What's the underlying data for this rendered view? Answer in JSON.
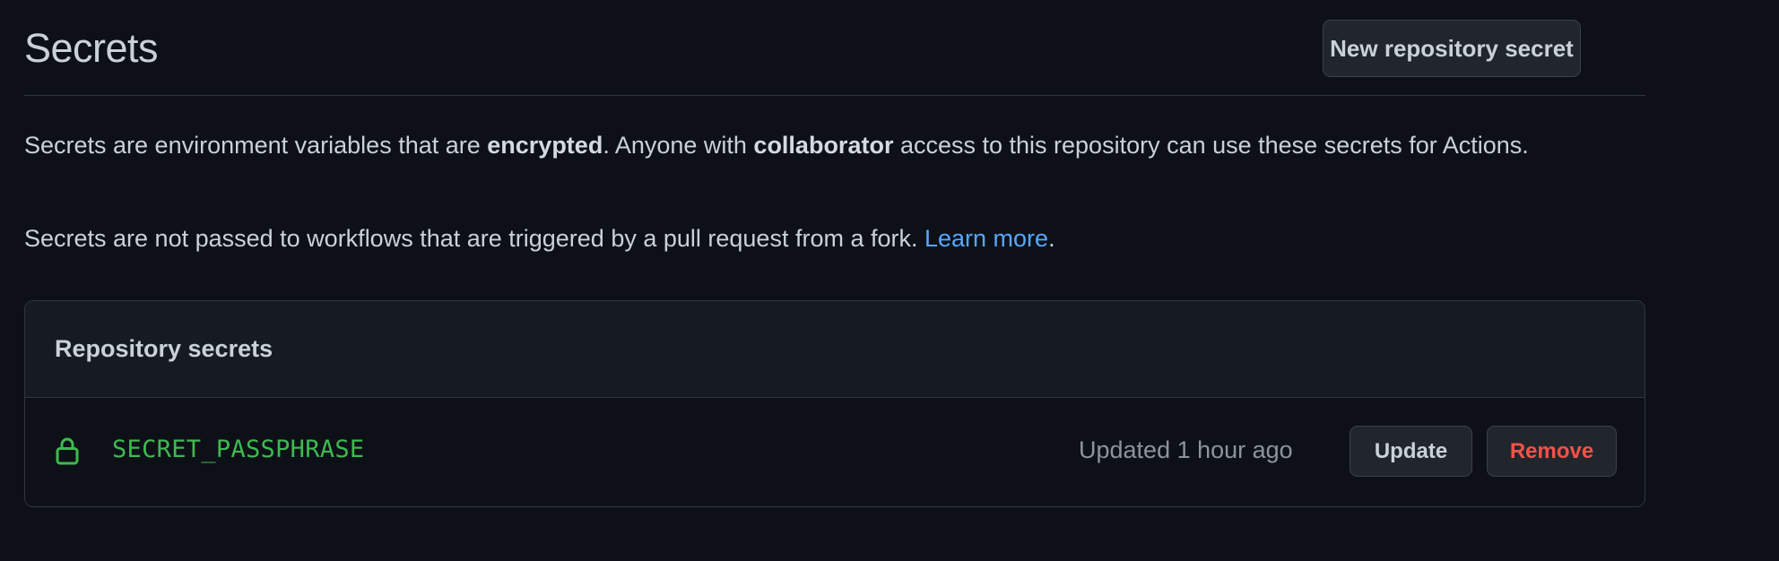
{
  "header": {
    "title": "Secrets",
    "new_secret_label": "New repository secret"
  },
  "description": {
    "p1_a": "Secrets are environment variables that are ",
    "p1_b": "encrypted",
    "p1_c": ". Anyone with ",
    "p1_d": "collaborator",
    "p1_e": " access to this repository can use these secrets for Actions.",
    "p2_a": "Secrets are not passed to workflows that are triggered by a pull request from a fork. ",
    "p2_link": "Learn more",
    "p2_end": "."
  },
  "repository_secrets": {
    "title": "Repository secrets",
    "items": [
      {
        "icon": "lock-icon",
        "name": "SECRET_PASSPHRASE",
        "updated": "Updated 1 hour ago",
        "update_label": "Update",
        "remove_label": "Remove"
      }
    ]
  },
  "colors": {
    "background": "#0d1117",
    "link": "#58a6ff",
    "secret_name": "#3fb950",
    "danger": "#f85149"
  }
}
